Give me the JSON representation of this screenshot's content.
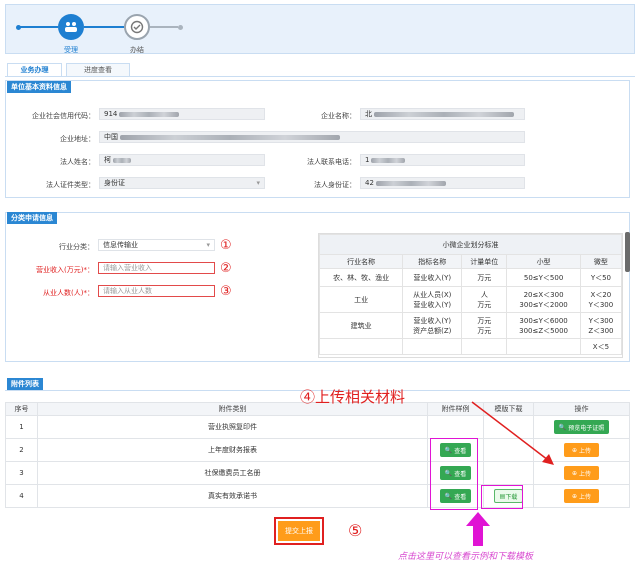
{
  "steps": [
    {
      "label": "受理"
    },
    {
      "label": "办结"
    }
  ],
  "tabs": [
    {
      "label": "业务办理"
    },
    {
      "label": "进度查看"
    }
  ],
  "unit": {
    "title": "单位基本资料信息",
    "credit_label": "企业社会信用代码：",
    "credit_value": "914",
    "name_label": "企业名称：",
    "name_value": "北",
    "addr_label": "企业地址：",
    "addr_value": "中国",
    "legal_label": "法人姓名：",
    "legal_value": "柯",
    "phone_label": "法人联系电话：",
    "phone_value": "1",
    "idtype_label": "法人证件类型：",
    "idtype_value": "身份证",
    "id_label": "法人身份证：",
    "id_value": "42"
  },
  "classify": {
    "title": "分类申请信息",
    "industry_label": "行业分类：",
    "industry_value": "信息传输业",
    "revenue_label": "营业收入(万元)*：",
    "revenue_placeholder": "请输入营业收入",
    "staff_label": "从业人数(人)*：",
    "staff_placeholder": "请输入从业人数",
    "marks": [
      "①",
      "②",
      "③"
    ]
  },
  "std": {
    "caption": "小微企业划分标准",
    "headers": [
      "行业名称",
      "指标名称",
      "计量单位",
      "小型",
      "微型"
    ],
    "rows": [
      [
        "农、林、牧、渔业",
        "营业收入(Y)",
        "万元",
        "50≤Y＜500",
        "Y＜50"
      ],
      [
        "工业",
        "从业人员(X)\n营业收入(Y)",
        "人\n万元",
        "20≤X＜300\n300≤Y＜2000",
        "X＜20\nY＜300"
      ],
      [
        "建筑业",
        "营业收入(Y)\n资产总额(Z)",
        "万元\n万元",
        "300≤Y＜6000\n300≤Z＜5000",
        "Y＜300\nZ＜300"
      ],
      [
        "",
        "",
        "",
        "",
        "X＜5"
      ]
    ]
  },
  "attach": {
    "title": "附件列表",
    "headers": [
      "序号",
      "附件类别",
      "附件样例",
      "模版下载",
      "操作"
    ],
    "rows": [
      {
        "no": "1",
        "name": "营业执照复印件"
      },
      {
        "no": "2",
        "name": "上年度财务报表"
      },
      {
        "no": "3",
        "name": "社保缴费员工名册"
      },
      {
        "no": "4",
        "name": "真实有效承诺书"
      }
    ],
    "view_label": "查看",
    "download_label": "下载",
    "upload_label": "上传",
    "preview_label": "预览电子证照"
  },
  "annot": {
    "upload_note": "④上传相关材料",
    "submit_mark": "⑤",
    "view_note": "点击这里可以查看示例和下载模板"
  },
  "submit_label": "提交上报"
}
